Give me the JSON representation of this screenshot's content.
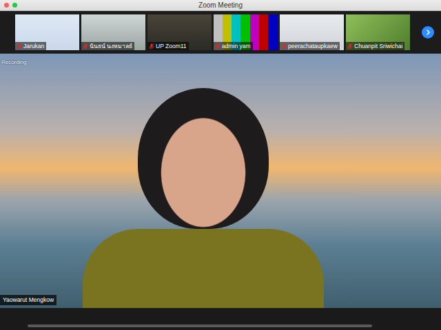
{
  "window": {
    "title": "Zoom Meeting"
  },
  "gallery": {
    "participants": [
      {
        "name": "Jarukan",
        "muted": true
      },
      {
        "name": "นันธน์ นงหมาลย์",
        "muted": true
      },
      {
        "name": "UP Zoom11",
        "muted": true
      },
      {
        "name": "admin yam",
        "muted": true
      },
      {
        "name": "peerachataupkaew",
        "muted": true
      },
      {
        "name": "Chuanpit Sriwichai",
        "muted": true
      }
    ]
  },
  "recording": {
    "label": "Recording"
  },
  "speaker": {
    "name": "Yaowarut Mengkow"
  }
}
